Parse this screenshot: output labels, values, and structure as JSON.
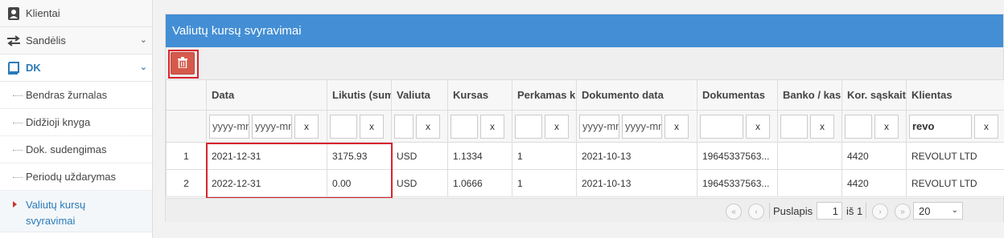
{
  "sidebar": {
    "items": [
      {
        "label": "Klientai",
        "icon": "contact-book-icon"
      },
      {
        "label": "Sandėlis",
        "icon": "transfer-arrows-icon"
      },
      {
        "label": "DK",
        "icon": "book-icon"
      }
    ],
    "subitems": [
      {
        "label": "Bendras žurnalas"
      },
      {
        "label": "Didžioji knyga"
      },
      {
        "label": "Dok. sudengimas"
      },
      {
        "label": "Periodų uždarymas"
      },
      {
        "label": "Valiutų kursų svyravimai"
      }
    ]
  },
  "panel": {
    "title": "Valiutų kursų svyravimai",
    "delete_icon": "trash-icon"
  },
  "table": {
    "columns": [
      "Data",
      "Likutis (sum",
      "Valiuta",
      "Kursas",
      "Perkamas k",
      "Dokumento data",
      "Dokumentas",
      "Banko / kas",
      "Kor. sąskait",
      "Klientas"
    ],
    "filters": {
      "date_placeholder_from": "yyyy-mm",
      "date_placeholder_to": "yyyy-mm",
      "doc_date_from": "yyyy-mm",
      "doc_date_to": "yyyy-mm",
      "client": "revo",
      "clear": "x"
    },
    "rows": [
      {
        "n": "1",
        "data": "2021-12-31",
        "likutis": "3175.93",
        "valiuta": "USD",
        "kursas": "1.1334",
        "perkamas": "1",
        "dok_data": "2021-10-13",
        "dokumentas": "19645337563...",
        "banko": "",
        "kor": "4420",
        "klientas": "REVOLUT LTD"
      },
      {
        "n": "2",
        "data": "2022-12-31",
        "likutis": "0.00",
        "valiuta": "USD",
        "kursas": "1.0666",
        "perkamas": "1",
        "dok_data": "2021-10-13",
        "dokumentas": "19645337563...",
        "banko": "",
        "kor": "4420",
        "klientas": "REVOLUT LTD"
      }
    ]
  },
  "pager": {
    "page_label": "Puslapis",
    "page": "1",
    "of_label": "iš 1",
    "page_size": "20",
    "first": "«",
    "prev": "‹",
    "next": "›",
    "last": "»"
  },
  "colors": {
    "header": "#438ed4",
    "delete_button": "#d55a4c",
    "highlight": "#d9232e"
  }
}
